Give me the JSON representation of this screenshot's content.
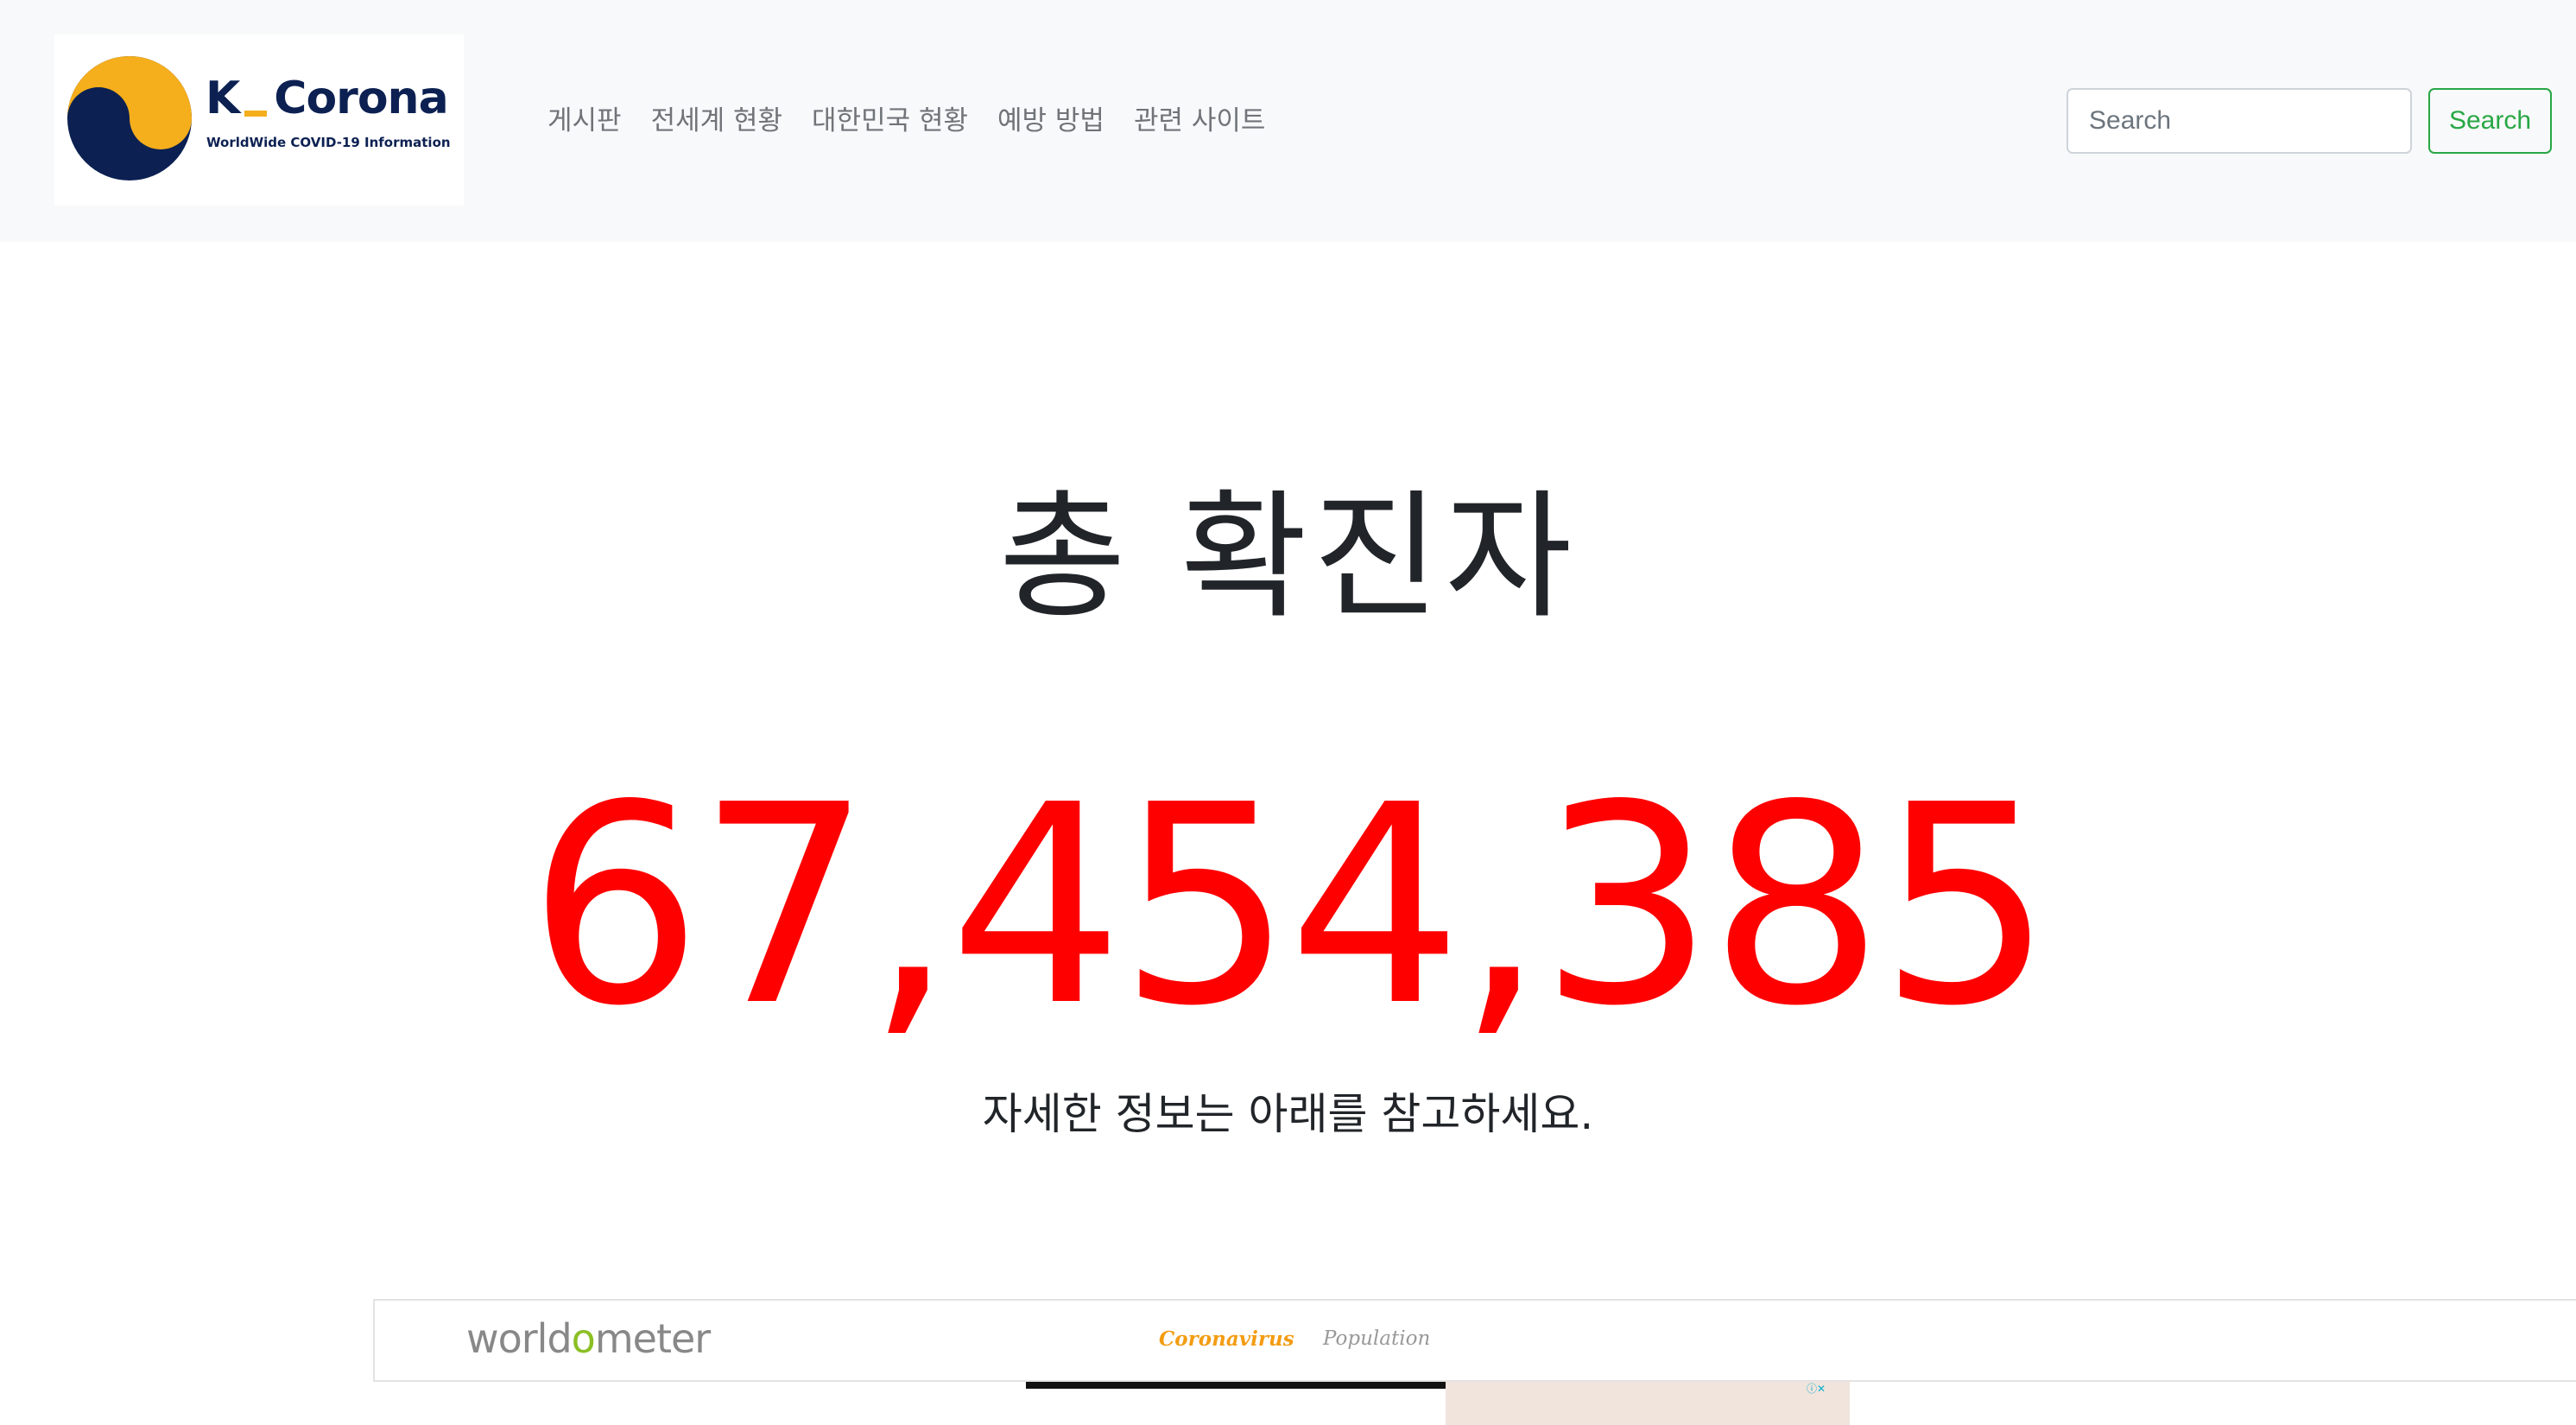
{
  "brand": {
    "title_prefix": "K",
    "title_suffix": "Corona",
    "tagline": "WorldWide COVID-19 Information",
    "colors": {
      "navy": "#0c2152",
      "gold": "#f5ae1c"
    }
  },
  "nav": {
    "items": [
      {
        "label": "게시판"
      },
      {
        "label": "전세계 현황"
      },
      {
        "label": "대한민국 현황"
      },
      {
        "label": "예방 방법"
      },
      {
        "label": "관련 사이트"
      }
    ]
  },
  "search": {
    "placeholder": "Search",
    "value": "",
    "button_label": "Search",
    "button_color": "#28a745"
  },
  "hero": {
    "title": "총 확진자",
    "count": "67,454,385",
    "count_color": "#ff0000",
    "note": "자세한 정보는 아래를 참고하세요."
  },
  "embed": {
    "logo_start": "world",
    "logo_accent": "o",
    "logo_end": "meter",
    "links": [
      {
        "label": "Coronavirus",
        "active": true
      },
      {
        "label": "Population",
        "active": false
      }
    ],
    "ad_choices_icon": "adchoices-icon"
  }
}
